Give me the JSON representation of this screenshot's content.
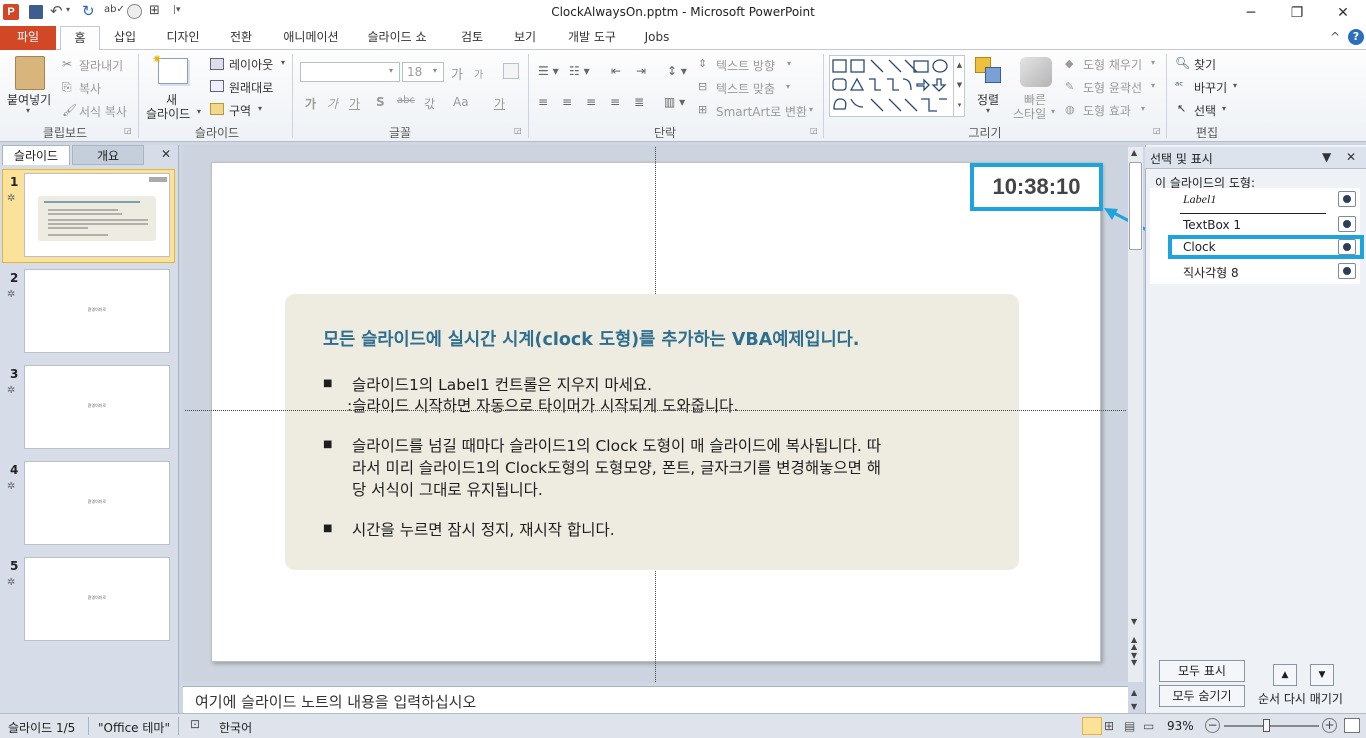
{
  "window": {
    "title": "ClockAlwaysOn.pptm - Microsoft PowerPoint",
    "quick_access": [
      "save-icon",
      "undo-icon",
      "redo-icon",
      "spelling-icon",
      "record-icon",
      "org-icon",
      "dropdown-icon"
    ],
    "controls": {
      "minimize": "─",
      "maximize": "❐",
      "close": "✕"
    }
  },
  "tabs": [
    "파일",
    "홈",
    "삽입",
    "디자인",
    "전환",
    "애니메이션",
    "슬라이드 쇼",
    "검토",
    "보기",
    "개발 도구",
    "Jobs"
  ],
  "help": {
    "collapse": "^",
    "help": "?"
  },
  "ribbon": {
    "clipboard": {
      "paste": "붙여넣기",
      "cut": "잘라내기",
      "copy": "복사",
      "format_painter": "서식 복사",
      "label": "클립보드"
    },
    "slides": {
      "new_slide_line1": "새",
      "new_slide_line2": "슬라이드",
      "layout": "레이아웃",
      "reset": "원래대로",
      "section": "구역",
      "label": "슬라이드"
    },
    "font": {
      "size": "18",
      "label": "글꼴",
      "grow": "가",
      "shrink": "가",
      "bold": "가",
      "italic": "가",
      "underline": "가",
      "shadow": "S",
      "strike": "abc",
      "spacing": "갃",
      "case": "Aa",
      "color": "가"
    },
    "paragraph": {
      "text_direction": "텍스트 방향",
      "align_text": "텍스트 맞춤",
      "smartart": "SmartArt로 변환",
      "label": "단락"
    },
    "drawing": {
      "arrange": "정렬",
      "quick_styles_line1": "빠른",
      "quick_styles_line2": "스타일",
      "fill": "도형 채우기",
      "outline": "도형 윤곽선",
      "effects": "도형 효과",
      "label": "그리기"
    },
    "editing": {
      "find": "찾기",
      "replace": "바꾸기",
      "select": "선택",
      "label": "편집"
    }
  },
  "left_pane": {
    "tabs": [
      "슬라이드",
      "개요"
    ],
    "slides": [
      {
        "num": "1",
        "selected": true
      },
      {
        "num": "2",
        "text": "환영이미로"
      },
      {
        "num": "3",
        "text": "환영이미로"
      },
      {
        "num": "4",
        "text": "환영이미로"
      },
      {
        "num": "5",
        "text": "환영이미로"
      }
    ]
  },
  "slide": {
    "clock": "10:38:10",
    "heading": "모든 슬라이드에 실시간 시계(clock 도형)를 추가하는 VBA예제입니다.",
    "bullets": [
      {
        "line1": "슬라이드1의 Label1 컨트롤은 지우지 마세요.",
        "line2": ":슬라이드 시작하면 자동으로 타이머가 시작되게 도와줍니다."
      },
      {
        "line1": "슬라이드를 넘길 때마다 슬라이드1의 Clock 도형이 매 슬라이드에 복사됩니다. 따",
        "line2": "라서 미리 슬라이드1의 Clock도형의 도형모양, 폰트, 글자크기를 변경해놓으면 해",
        "line3": "당 서식이 그대로 유지됩니다."
      },
      {
        "line1": "시간을 누르면 잠시 정지, 재시작 합니다."
      }
    ]
  },
  "notes_placeholder": "여기에 슬라이드 노트의 내용을 입력하십시오",
  "selection_pane": {
    "title": "선택 및 표시",
    "subtitle": "이 슬라이드의 도형:",
    "items": [
      "Label1",
      "TextBox 1",
      "Clock",
      "직사각형 8"
    ],
    "selected": "Clock",
    "show_all": "모두 표시",
    "hide_all": "모두 숨기기",
    "reorder": "순서 다시 매기기"
  },
  "status": {
    "slide_pos": "슬라이드 1/5",
    "theme": "\"Office 테마\"",
    "language": "한국어",
    "zoom": "93%"
  },
  "colors": {
    "accent": "#1ea3dc",
    "file_tab": "#d24726",
    "heading": "#2e6e8e",
    "textbox": "#eeebe1"
  }
}
